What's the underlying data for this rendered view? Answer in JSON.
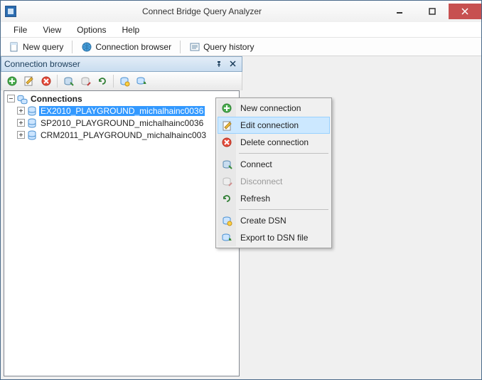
{
  "window": {
    "title": "Connect Bridge Query Analyzer"
  },
  "menu": {
    "items": [
      "File",
      "View",
      "Options",
      "Help"
    ]
  },
  "toolbar": {
    "new_query": "New query",
    "connection_browser": "Connection browser",
    "query_history": "Query history"
  },
  "panel": {
    "title": "Connection browser",
    "root": "Connections",
    "nodes": [
      "EX2010_PLAYGROUND_michalhainc0036",
      "SP2010_PLAYGROUND_michalhainc0036",
      "CRM2011_PLAYGROUND_michalhainc003"
    ],
    "selected_index": 0
  },
  "context_menu": {
    "items": [
      {
        "label": "New connection",
        "enabled": true
      },
      {
        "label": "Edit connection",
        "enabled": true,
        "highlight": true
      },
      {
        "label": "Delete connection",
        "enabled": true
      }
    ],
    "group2": [
      {
        "label": "Connect",
        "enabled": true
      },
      {
        "label": "Disconnect",
        "enabled": false
      },
      {
        "label": "Refresh",
        "enabled": true
      }
    ],
    "group3": [
      {
        "label": "Create DSN",
        "enabled": true
      },
      {
        "label": "Export to DSN file",
        "enabled": true
      }
    ]
  }
}
